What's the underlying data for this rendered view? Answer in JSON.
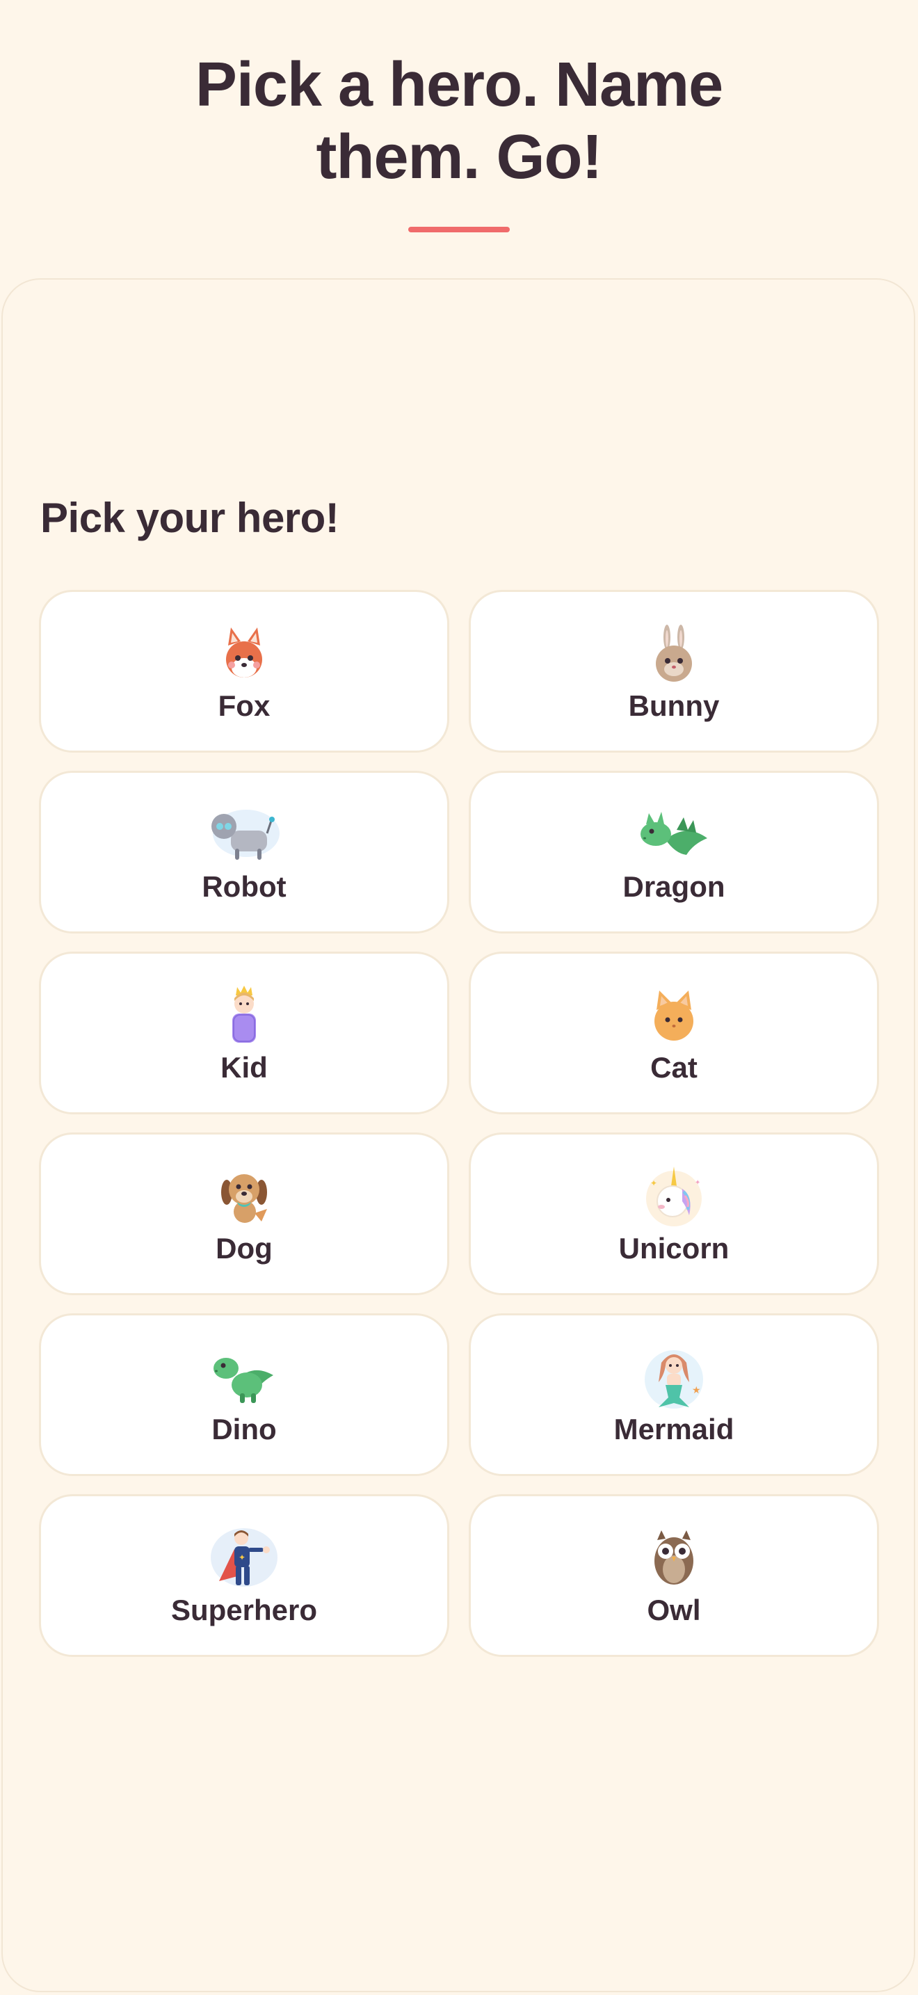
{
  "header": {
    "title_line1": "Pick a hero. Name",
    "title_line2": "them. Go!",
    "accent_color": "#f06b6b"
  },
  "picker": {
    "heading": "Pick your hero!",
    "heroes": [
      {
        "label": "Fox",
        "icon": "fox-icon"
      },
      {
        "label": "Bunny",
        "icon": "bunny-icon"
      },
      {
        "label": "Robot",
        "icon": "robot-icon"
      },
      {
        "label": "Dragon",
        "icon": "dragon-icon"
      },
      {
        "label": "Kid",
        "icon": "kid-icon"
      },
      {
        "label": "Cat",
        "icon": "cat-icon"
      },
      {
        "label": "Dog",
        "icon": "dog-icon"
      },
      {
        "label": "Unicorn",
        "icon": "unicorn-icon"
      },
      {
        "label": "Dino",
        "icon": "dino-icon"
      },
      {
        "label": "Mermaid",
        "icon": "mermaid-icon"
      },
      {
        "label": "Superhero",
        "icon": "superhero-icon"
      },
      {
        "label": "Owl",
        "icon": "owl-icon"
      }
    ]
  }
}
